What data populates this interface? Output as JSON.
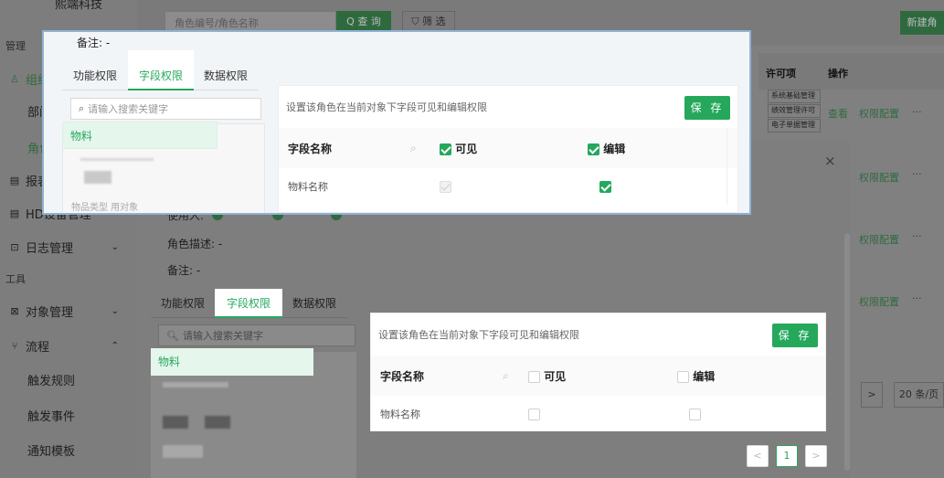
{
  "sidebar": {
    "brand": "熙端科技",
    "section_manage": "管理",
    "item_org": "组织",
    "sub_dept": "部门",
    "sub_role": "角色",
    "item_reports": "报表",
    "item_hd": "HD设备管理",
    "item_logs": "日志管理",
    "section_tools": "工具",
    "item_objects": "对象管理",
    "item_flow": "流程",
    "flow_children": [
      "触发规则",
      "触发事件",
      "通知模板"
    ]
  },
  "background": {
    "search_placeholder": "角色编号/角色名称",
    "query_label": "Q 查 询",
    "filter_label": "筛 选",
    "new_button": "新建角",
    "col_license": "许可项",
    "col_actions": "操作",
    "license_chips": [
      "系统基础管理",
      "绩效管理许可",
      "电子单据管理"
    ],
    "view_link": "查看",
    "perm_link": "权限配置",
    "more": "···",
    "page_size": "20 条/页"
  },
  "modal": {
    "close": "×",
    "used_by": "使用人:",
    "desc_label": "角色描述: -",
    "remark_label": "备注: -",
    "tabs": [
      "功能权限",
      "字段权限",
      "数据权限"
    ],
    "search_placeholder": "请输入搜索关键字",
    "tree_selected": "物料",
    "panel_hint": "设置该角色在当前对象下字段可见和编辑权限",
    "save": "保 存",
    "th_field": "字段名称",
    "th_visible": "可见",
    "th_edit": "编辑",
    "row_name": "物料名称",
    "pages": [
      "<",
      "1",
      ">"
    ]
  },
  "popup": {
    "remark_label": "备注: -",
    "tabs": [
      "功能权限",
      "字段权限",
      "数据权限"
    ],
    "search_placeholder": "请输入搜索关键字",
    "tree_selected": "物料",
    "tree_footnote": "物品类型 用对象",
    "panel_hint": "设置该角色在当前对象下字段可见和编辑权限",
    "save": "保 存",
    "th_field": "字段名称",
    "th_visible": "可见",
    "th_edit": "编辑",
    "row_name": "物料名称"
  },
  "colors": {
    "accent": "#25a85c",
    "highlight": "#e5f6ec",
    "window_border": "#8fb2d3"
  }
}
